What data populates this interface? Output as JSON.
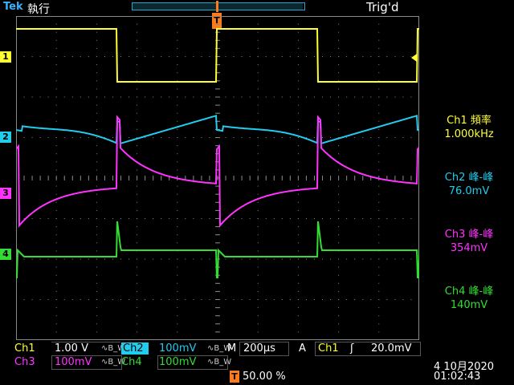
{
  "header": {
    "brand": "Tek",
    "acq_state": "執行",
    "trigger_status": "Trig'd",
    "trigger_marker": "T"
  },
  "colors": {
    "ch1": "#ffff33",
    "ch2": "#22ccee",
    "ch3": "#ff33ff",
    "ch4": "#33dd33",
    "grid": "#888888",
    "trigger_marker": "#ff7a1a"
  },
  "channels": [
    {
      "id": "1",
      "color": "#ffff33"
    },
    {
      "id": "2",
      "color": "#22ccee"
    },
    {
      "id": "3",
      "color": "#ff33ff"
    },
    {
      "id": "4",
      "color": "#33dd33"
    }
  ],
  "measurements": [
    {
      "label": "Ch1 頻率",
      "value": "1.000kHz",
      "color": "#ffff33"
    },
    {
      "label": "Ch2 峰-峰",
      "value": "76.0mV",
      "color": "#22ccee"
    },
    {
      "label": "Ch3 峰-峰",
      "value": "354mV",
      "color": "#ff33ff"
    },
    {
      "label": "Ch4 峰-峰",
      "value": "140mV",
      "color": "#33dd33"
    }
  ],
  "status": {
    "ch1_name": "Ch1",
    "ch1_scale": "1.00 V",
    "ch2_name": "Ch2",
    "ch2_scale": "100mV",
    "ch3_name": "Ch3",
    "ch3_scale": "100mV",
    "ch4_name": "Ch4",
    "ch4_scale": "100mV",
    "bw_symbol": "∿B_W",
    "timebase_label": "M",
    "timebase": "200µs",
    "acq_mode": "A",
    "trig_source": "Ch1",
    "trig_slope": "ʃ",
    "trig_level": "20.0mV",
    "trig_pos_marker": "T",
    "trig_position": "50.00 %",
    "date": "4 10月2020",
    "time": "01:02:43"
  }
}
